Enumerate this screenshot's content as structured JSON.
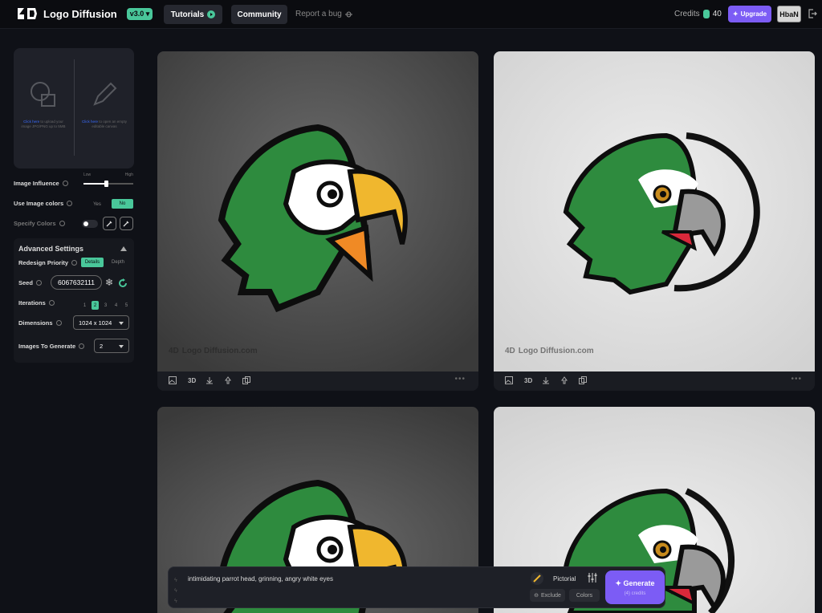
{
  "header": {
    "app_name": "Logo Diffusion",
    "version": "v3.0",
    "nav": [
      {
        "label": "Tutorials"
      },
      {
        "label": "Community"
      }
    ],
    "report_bug": "Report a bug",
    "credits_label": "Credits",
    "credits_value": "40",
    "upgrade_label": "Upgrade",
    "user_initials": "HbaN"
  },
  "upload": {
    "image_link": "Click here",
    "image_text": "to upload your image JPG/PNG up to 5MB",
    "canvas_link": "Click here",
    "canvas_text": "to open an empty editable canvas"
  },
  "controls": {
    "image_influence": "Image Influence",
    "influence_low": "Low",
    "influence_high": "High",
    "influence_level": 0.45,
    "use_image_colors": "Use Image colors",
    "yes": "Yes",
    "no": "No",
    "specify_colors": "Specify Colors"
  },
  "advanced": {
    "title": "Advanced Settings",
    "redesign_priority": "Redesign Priority",
    "priority_details": "Details",
    "priority_depth": "Depth",
    "seed_label": "Seed",
    "seed_value": "6067632111",
    "iterations_label": "Iterations",
    "iterations": [
      "1",
      "2",
      "3",
      "4",
      "5"
    ],
    "iterations_selected": "2",
    "dimensions_label": "Dimensions",
    "dimensions_value": "1024 x 1024",
    "images_label": "Images To Generate",
    "images_value": "2"
  },
  "gallery": {
    "watermark": "Logo Diffusion.com",
    "toolbar_3d": "3D"
  },
  "prompt": {
    "text": "intimidating parrot head, grinning, angry white eyes",
    "style": "Pictorial",
    "exclude": "Exclude",
    "colors": "Colors",
    "generate": "Generate",
    "generate_cost": "(4) credits"
  },
  "colors": {
    "accent": "#7c5cf5",
    "green": "#49c79a",
    "link_blue": "#3a6cff"
  }
}
